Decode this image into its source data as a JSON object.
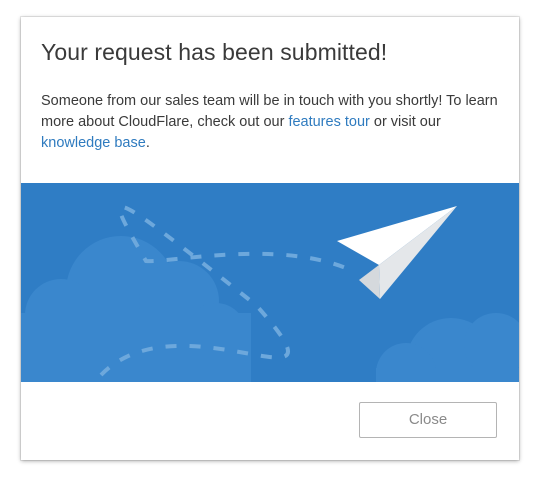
{
  "modal": {
    "title": "Your request has been submitted!",
    "message_part1": "Someone from our sales team will be in touch with you shortly! To learn more about CloudFlare, check out our ",
    "features_tour_link": "features tour",
    "message_part2": " or visit our ",
    "knowledge_base_link": "knowledge base",
    "message_part3": ".",
    "close_label": "Close"
  },
  "illustration": {
    "icon": "paper-plane-icon",
    "background_color": "#2f7dc5"
  },
  "colors": {
    "link": "#2f7bbf",
    "text": "#3a3a3a",
    "button_text": "#8a8a8a",
    "button_border": "#b4b4b4"
  }
}
